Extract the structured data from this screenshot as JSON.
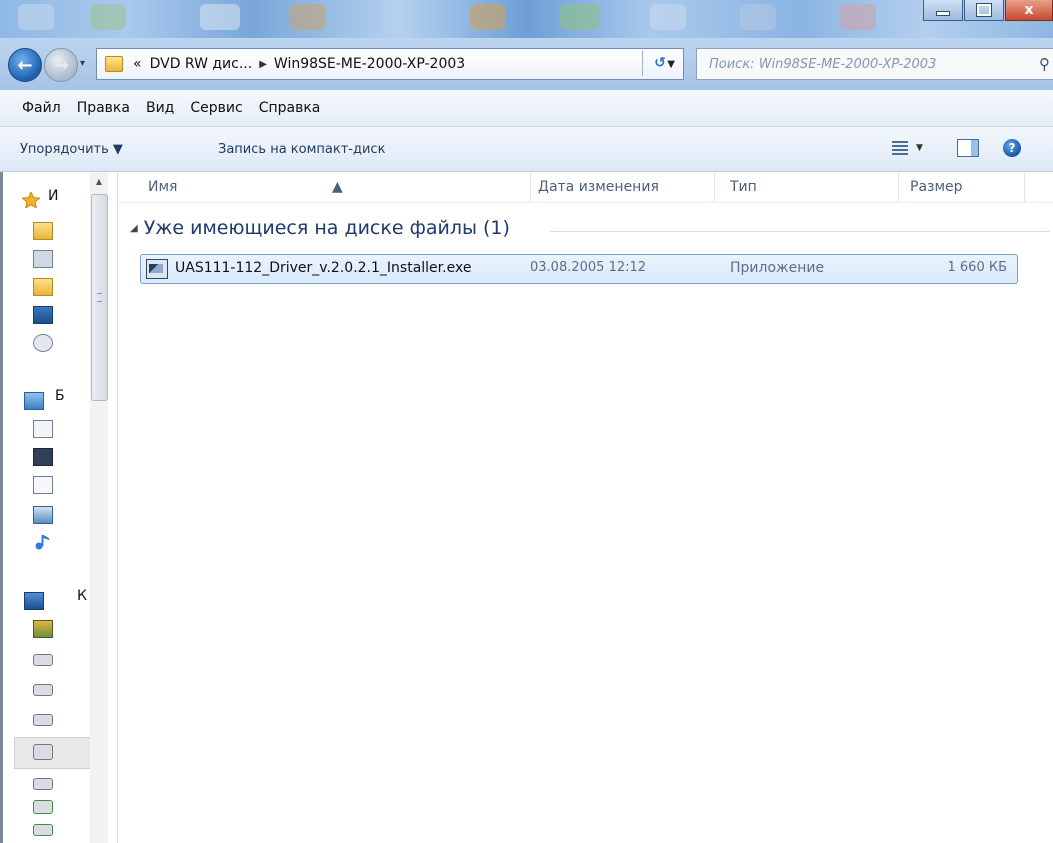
{
  "window": {
    "close_glyph": "x"
  },
  "address": {
    "recent_glyph": "▾",
    "overflow": "«",
    "crumbs": [
      "DVD RW дис...",
      "Win98SE-ME-2000-XP-2003"
    ],
    "separator": "▶",
    "dropdown_glyph": "▼",
    "refresh_glyph": "↺",
    "search_placeholder": "Поиск: Win98SE-ME-2000-XP-2003",
    "search_glyph": "⚲"
  },
  "menubar": {
    "items": [
      "Файл",
      "Правка",
      "Вид",
      "Сервис",
      "Справка"
    ]
  },
  "toolbar": {
    "organize": "Упорядочить ▼",
    "burn": "Запись на компакт-диск",
    "view_arrow": "▼",
    "help_glyph": "?"
  },
  "navpane": {
    "favorites_label": "И",
    "libraries_label": "Б",
    "computer_label": "К",
    "scroll_up": "▲"
  },
  "columns": {
    "name": "Имя",
    "date": "Дата изменения",
    "type": "Тип",
    "size": "Размер",
    "sort_glyph": "▲"
  },
  "group": {
    "toggle": "◢",
    "label": "Уже имеющиеся на диске файлы (1)"
  },
  "files": [
    {
      "name": "UAS111-112_Driver_v.2.0.2.1_Installer.exe",
      "date": "03.08.2005 12:12",
      "type": "Приложение",
      "size": "1 660 КБ"
    }
  ],
  "colors": {
    "accent": "#1e3a6e",
    "selection": "#d9e9fb",
    "selection_border": "#7da2ce"
  }
}
